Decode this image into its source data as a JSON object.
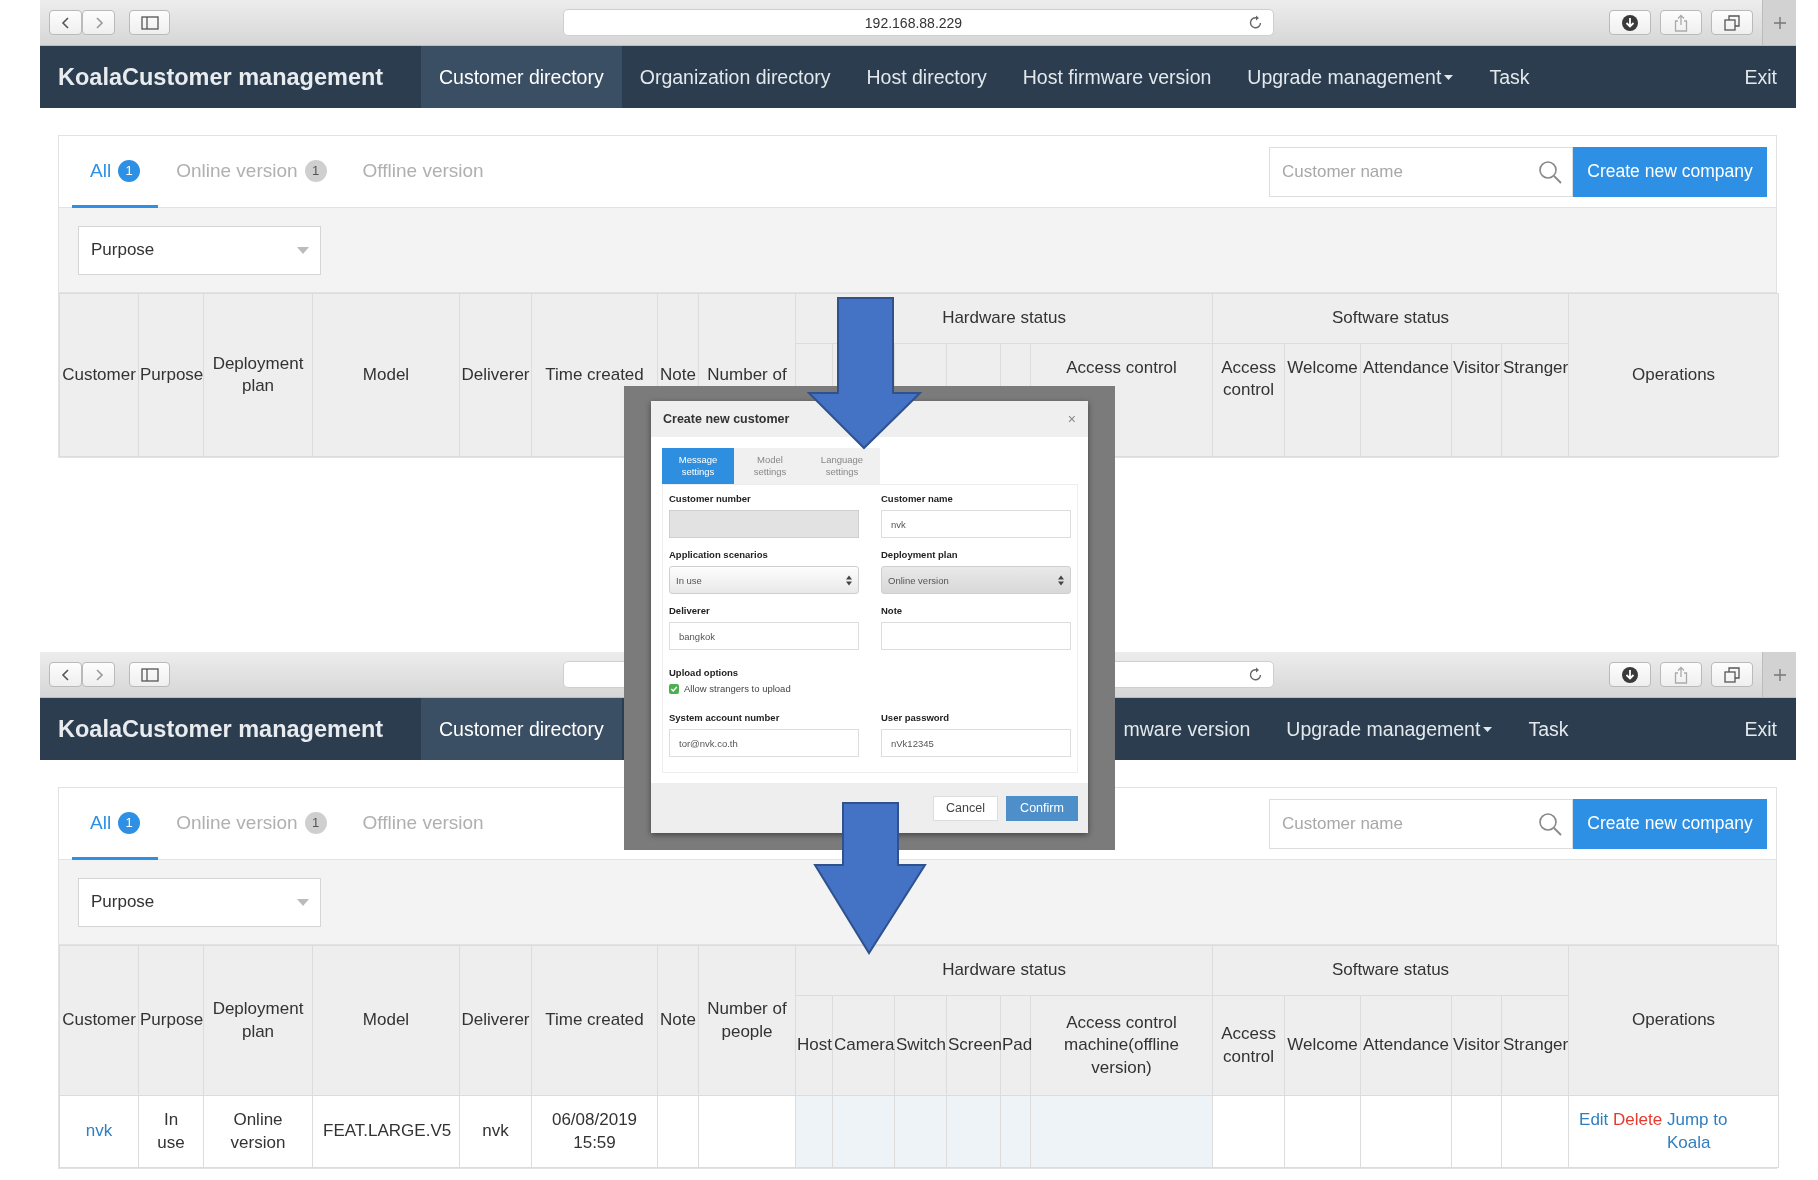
{
  "screens": [
    {
      "browser": {
        "url": "192.168.88.229"
      },
      "nav": {
        "brand": "KoalaCustomer management",
        "items": [
          {
            "label": "Customer directory",
            "selected": true,
            "dropdown": false
          },
          {
            "label": "Organization directory",
            "selected": false,
            "dropdown": false
          },
          {
            "label": "Host directory",
            "selected": false,
            "dropdown": false
          },
          {
            "label": "Host firmware version",
            "selected": false,
            "dropdown": false
          },
          {
            "label": "Upgrade management",
            "selected": false,
            "dropdown": true
          },
          {
            "label": "Task",
            "selected": false,
            "dropdown": false
          }
        ],
        "exit": "Exit"
      },
      "tabs": [
        {
          "label": "All",
          "count": "1",
          "selected": true
        },
        {
          "label": "Online version",
          "count": "1",
          "selected": false
        },
        {
          "label": "Offline version",
          "selected": false
        }
      ],
      "search": {
        "placeholder": "Customer name"
      },
      "create_button": "Create new company",
      "filter": {
        "placeholder": "Purpose"
      },
      "table": {
        "columns": [
          {
            "label": "Customer"
          },
          {
            "label": "Purpose"
          },
          {
            "label": "Deployment plan"
          },
          {
            "label": "Model"
          },
          {
            "label": "Deliverer"
          },
          {
            "label": "Time created"
          },
          {
            "label": "Note"
          },
          {
            "label": "Number of"
          },
          {
            "label": "Hardware status",
            "children": [
              {
                "label": "Access control"
              }
            ]
          },
          {
            "label": "Software status",
            "children": [
              {
                "label": "Access control"
              },
              {
                "label": "Welcome"
              },
              {
                "label": "Attendance"
              },
              {
                "label": "Visitor"
              },
              {
                "label": "Stranger"
              }
            ]
          },
          {
            "label": "Operations"
          }
        ]
      }
    },
    {
      "nav": {
        "brand": "KoalaCustomer management",
        "items": [
          {
            "label": "Customer directory",
            "selected": true,
            "dropdown": false
          },
          {
            "label": "mware version",
            "selected": false,
            "dropdown": false
          },
          {
            "label": "Upgrade management",
            "selected": false,
            "dropdown": true
          },
          {
            "label": "Task",
            "selected": false,
            "dropdown": false
          }
        ],
        "exit": "Exit"
      },
      "tabs": [
        {
          "label": "All",
          "count": "1",
          "selected": true
        },
        {
          "label": "Online version",
          "count": "1",
          "selected": false
        },
        {
          "label": "Offline version",
          "selected": false
        }
      ],
      "search": {
        "placeholder": "Customer name"
      },
      "create_button": "Create new company",
      "filter": {
        "placeholder": "Purpose"
      },
      "table": {
        "columns": [
          {
            "label": "Customer"
          },
          {
            "label": "Purpose"
          },
          {
            "label": "Deployment plan"
          },
          {
            "label": "Model"
          },
          {
            "label": "Deliverer"
          },
          {
            "label": "Time created"
          },
          {
            "label": "Note"
          },
          {
            "label": "Number of people"
          },
          {
            "label": "Hardware status",
            "children": [
              {
                "label": "Host"
              },
              {
                "label": "Camera"
              },
              {
                "label": "Switch"
              },
              {
                "label": "Screen"
              },
              {
                "label": "Pad"
              },
              {
                "label": "Access control machine(offline version)"
              }
            ]
          },
          {
            "label": "Software status",
            "children": [
              {
                "label": "Access control"
              },
              {
                "label": "Welcome"
              },
              {
                "label": "Attendance"
              },
              {
                "label": "Visitor"
              },
              {
                "label": "Stranger"
              }
            ]
          },
          {
            "label": "Operations"
          }
        ],
        "rows": [
          {
            "customer": "nvk",
            "purpose": "In use",
            "deployment_plan": "Online version",
            "model": "FEAT.LARGE.V5",
            "deliverer": "nvk",
            "time_created": "06/08/2019 15:59",
            "operations": [
              {
                "label": "Edit",
                "color": "#2f7fc1"
              },
              {
                "label": "Delete",
                "color": "#e8392f"
              },
              {
                "label": "Jump to Koala",
                "color": "#2f7fc1"
              }
            ]
          }
        ]
      }
    }
  ],
  "dialog": {
    "title": "Create new customer",
    "close": "×",
    "tabs": [
      {
        "label": "Message settings",
        "selected": true
      },
      {
        "label": "Model settings",
        "selected": false
      },
      {
        "label": "Language settings",
        "selected": false
      }
    ],
    "fields": [
      {
        "label": "Customer number",
        "kind": "text",
        "disabled": true
      },
      {
        "label": "Customer name",
        "kind": "text",
        "value": "nvk",
        "disabled": false
      },
      {
        "label": "Application scenarios",
        "kind": "select",
        "value": "In use",
        "disabled": false
      },
      {
        "label": "Deployment plan",
        "kind": "select",
        "value": "Online version",
        "disabled": true
      },
      {
        "label": "Deliverer",
        "kind": "text",
        "value": "bangkok",
        "disabled": false
      },
      {
        "label": "Note",
        "kind": "text",
        "disabled": false
      }
    ],
    "upload": {
      "label": "Upload options",
      "option": {
        "label": "Allow strangers to upload",
        "checked": true
      }
    },
    "account_fields": [
      {
        "label": "System account number",
        "kind": "text",
        "value": "tor@nvk.co.th",
        "disabled": false
      },
      {
        "label": "User password",
        "kind": "text",
        "value": "nVk12345",
        "disabled": false
      }
    ],
    "buttons": [
      {
        "label": "Cancel",
        "primary": false
      },
      {
        "label": "Confirm",
        "primary": true
      }
    ]
  }
}
